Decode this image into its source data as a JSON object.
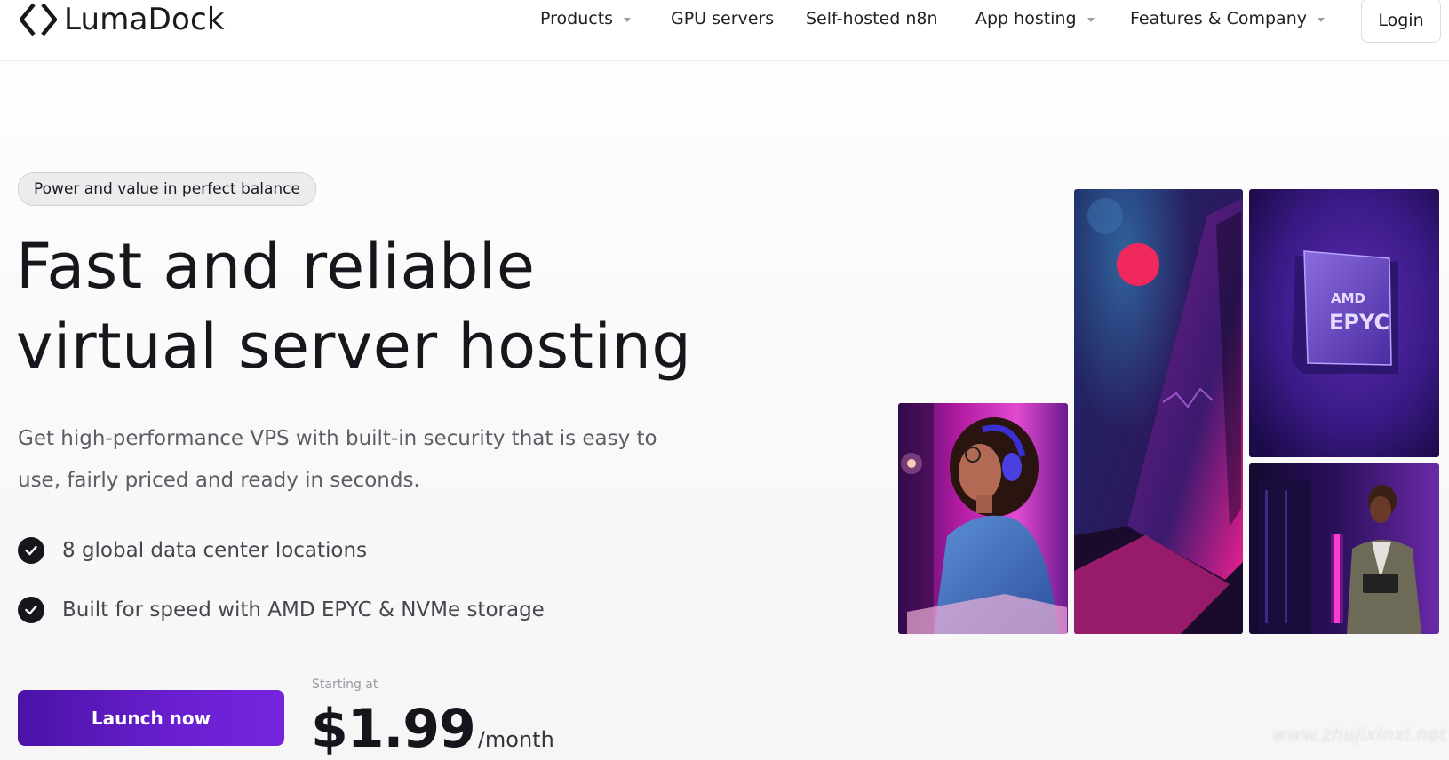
{
  "brand": {
    "name": "LumaDock",
    "logo_icon": "code-brackets-icon"
  },
  "nav": {
    "items": [
      {
        "label": "Products",
        "has_dropdown": true
      },
      {
        "label": "GPU servers",
        "has_dropdown": false
      },
      {
        "label": "Self-hosted n8n",
        "has_dropdown": false
      },
      {
        "label": "App hosting",
        "has_dropdown": true
      },
      {
        "label": "Features & Company",
        "has_dropdown": true
      }
    ],
    "login_label": "Login"
  },
  "hero": {
    "badge": "Power and value in perfect balance",
    "headline_line1": "Fast and reliable",
    "headline_line2": "virtual server hosting",
    "subtitle": "Get high-performance VPS with built-in security that is easy to use, fairly priced and ready in seconds.",
    "features": [
      "8 global data center locations",
      "Built for speed with AMD EPYC & NVMe storage"
    ],
    "cta_label": "Launch now",
    "price_caption": "Starting at",
    "price_amount": "$1.99",
    "price_unit": "/month"
  },
  "images": {
    "chip_label_line1": "AMD",
    "chip_label_line2": "EPYC"
  },
  "colors": {
    "accent": "#5b16c4",
    "text": "#17161c",
    "muted": "#5e5d66",
    "magenta": "#e1147a"
  },
  "watermark": "www.zhujixinxi.net"
}
